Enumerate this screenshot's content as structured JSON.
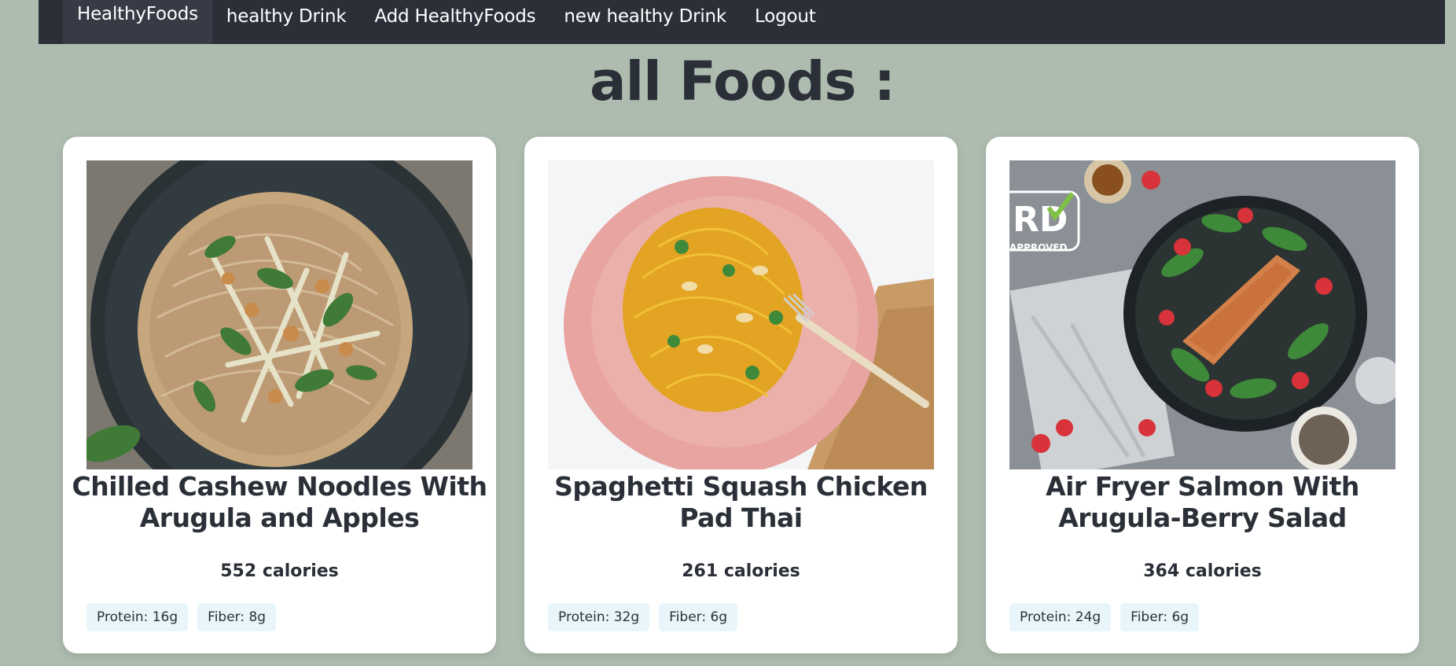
{
  "nav": {
    "items": [
      {
        "label": "HealthyFoods"
      },
      {
        "label": "healthy Drink"
      },
      {
        "label": "Add HealthyFoods"
      },
      {
        "label": "new healthy Drink"
      },
      {
        "label": "Logout"
      }
    ]
  },
  "page": {
    "title": "all Foods :"
  },
  "foods": [
    {
      "title": "Chilled Cashew Noodles With Arugula and Apples",
      "calories": "552 calories",
      "protein": "Protein: 16g",
      "fiber": "Fiber: 8g"
    },
    {
      "title": "Spaghetti Squash Chicken Pad Thai",
      "calories": "261 calories",
      "protein": "Protein: 32g",
      "fiber": "Fiber: 6g"
    },
    {
      "title": "Air Fryer Salmon With Arugula-Berry Salad",
      "calories": "364 calories",
      "protein": "Protein: 24g",
      "fiber": "Fiber: 6g"
    }
  ],
  "images": [
    {
      "badge_line1": "RD",
      "badge_line2": "APPROVED"
    }
  ],
  "colors": {
    "background": "#aebcb0",
    "navbar": "#2b2f38",
    "navbar_active": "#363b45",
    "title_text": "#2b2f38",
    "card": "#ffffff",
    "tag_bg": "#e8f6fc"
  }
}
